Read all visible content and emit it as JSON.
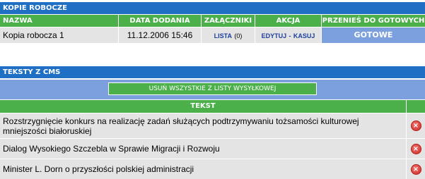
{
  "drafts": {
    "title": "KOPIE ROBOCZE",
    "columns": {
      "name": "NAZWA",
      "date_added": "DATA DODANIA",
      "attachments": "ZAŁĄCZNIKI",
      "action": "AKCJA",
      "move_to_ready": "PRZENIEŚ DO GOTOWYCH"
    },
    "rows": [
      {
        "name": "Kopia robocza 1",
        "date": "11.12.2006 15:46",
        "attachments_link": "LISTA",
        "attachments_count": "(0)",
        "edit_link": "EDYTUJ",
        "separator": "-",
        "delete_link": "KASUJ",
        "ready_button": "GOTOWE"
      }
    ]
  },
  "cms": {
    "title": "TEKSTY Z CMS",
    "remove_all_button": "USUŃ WSZYSTKIE Z LISTY WYSYŁKOWEJ",
    "column_text": "TEKST",
    "items": [
      {
        "text": "Rozstrzygnięcie konkurs na realizację zadań służących podtrzymywaniu tożsamości kulturowej mniejszości białoruskiej"
      },
      {
        "text": "Dialog Wysokiego Szczebla w Sprawie Migracji i Rozwoju"
      },
      {
        "text": "Minister L. Dorn o przyszłości polskiej administracji"
      }
    ]
  },
  "colors": {
    "header_blue": "#1f6fc4",
    "header_green": "#4bb04a",
    "light_blue": "#7ca0de",
    "row_gray": "#e4e4e4",
    "link_blue": "#1c3f9c",
    "delete_red": "#cf2a26"
  },
  "icons": {
    "delete": "delete-icon"
  }
}
